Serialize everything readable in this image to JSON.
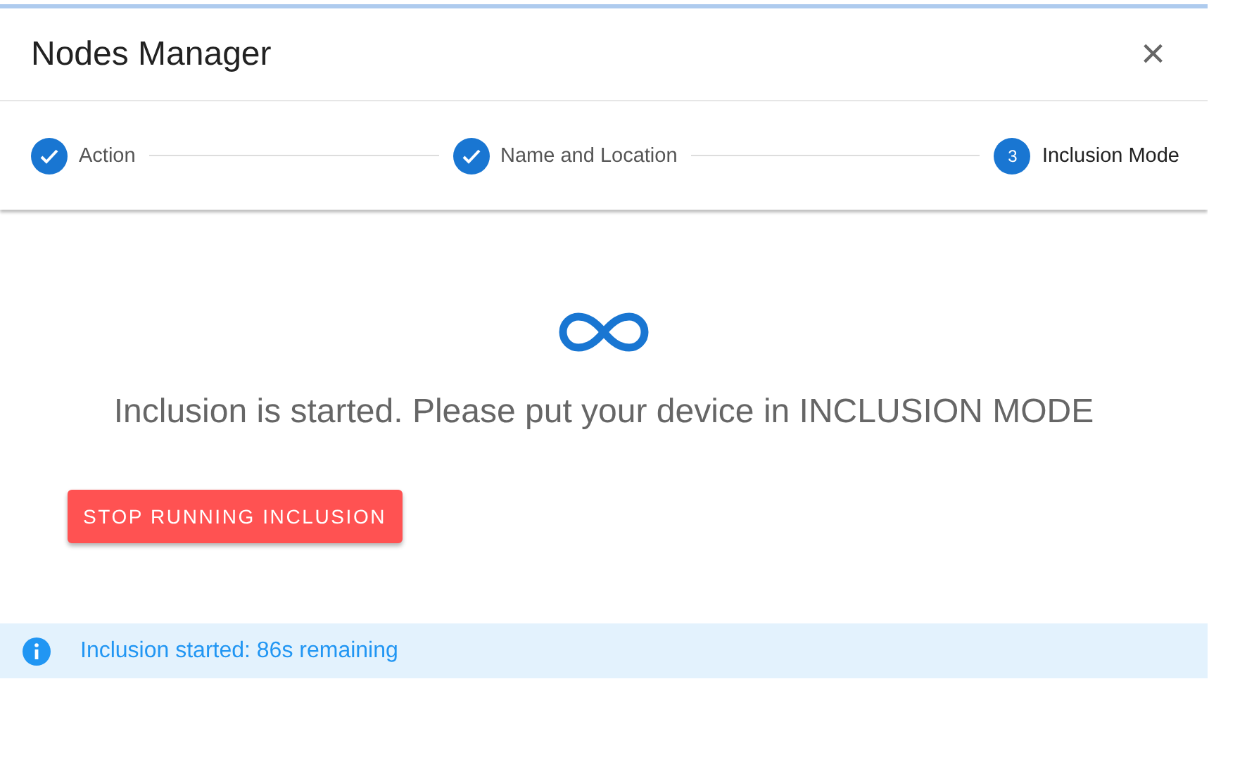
{
  "dialog": {
    "title": "Nodes Manager",
    "close": "×"
  },
  "steps": [
    {
      "label": "Action",
      "completed": true
    },
    {
      "label": "Name and Location",
      "completed": true
    },
    {
      "label": "Inclusion Mode",
      "number": "3",
      "completed": false
    }
  ],
  "message": "Inclusion is started. Please put your device in INCLUSION MODE",
  "stop_button": "STOP RUNNING INCLUSION",
  "alert": {
    "kind": "info",
    "text": "Inclusion started: 86s remaining"
  }
}
